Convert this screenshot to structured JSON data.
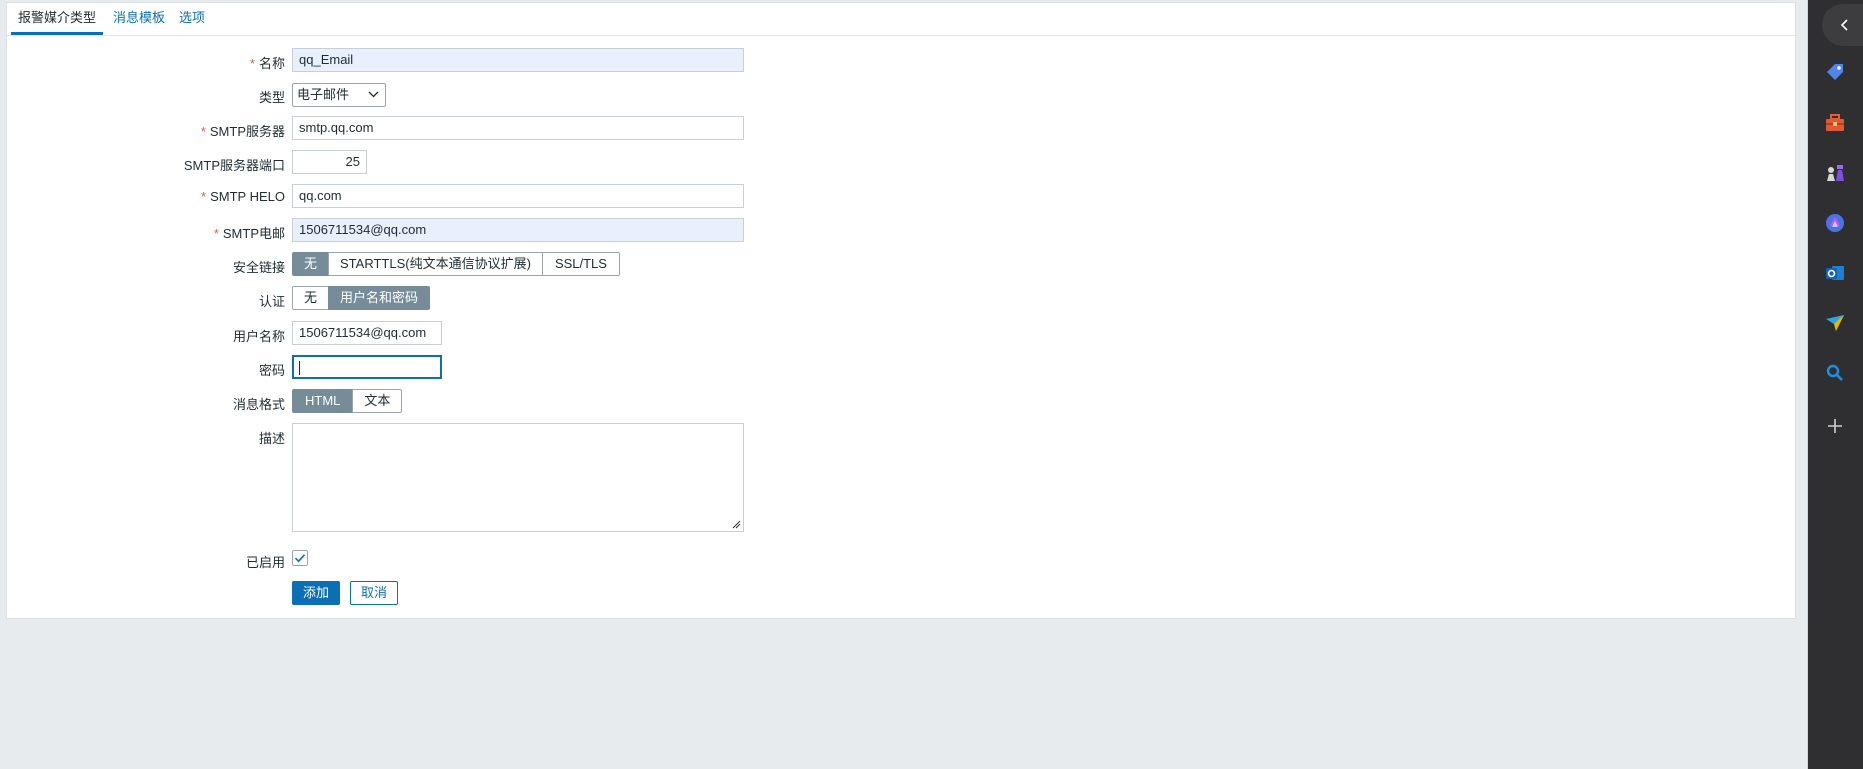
{
  "tabs": [
    {
      "label": "报警媒介类型",
      "active": true
    },
    {
      "label": "消息模板",
      "active": false
    },
    {
      "label": "选项",
      "active": false
    }
  ],
  "form": {
    "name": {
      "label": "名称",
      "required": true,
      "value": "qq_Email"
    },
    "type": {
      "label": "类型",
      "value": "电子邮件"
    },
    "smtp_server": {
      "label": "SMTP服务器",
      "required": true,
      "value": "smtp.qq.com"
    },
    "smtp_port": {
      "label": "SMTP服务器端口",
      "value": "25"
    },
    "smtp_helo": {
      "label": "SMTP HELO",
      "required": true,
      "value": "qq.com"
    },
    "smtp_email": {
      "label": "SMTP电邮",
      "required": true,
      "value": "1506711534@qq.com"
    },
    "security": {
      "label": "安全链接",
      "options": [
        "无",
        "STARTTLS(纯文本通信协议扩展)",
        "SSL/TLS"
      ],
      "selected": "无"
    },
    "auth": {
      "label": "认证",
      "options": [
        "无",
        "用户名和密码"
      ],
      "selected": "用户名和密码"
    },
    "username": {
      "label": "用户名称",
      "value": "1506711534@qq.com"
    },
    "password": {
      "label": "密码",
      "value": ""
    },
    "message_format": {
      "label": "消息格式",
      "options": [
        "HTML",
        "文本"
      ],
      "selected": "HTML"
    },
    "description": {
      "label": "描述",
      "value": ""
    },
    "enabled": {
      "label": "已启用",
      "checked": true
    },
    "add_label": "添加",
    "cancel_label": "取消"
  },
  "required_marker": "*",
  "sidebar": {
    "icons": [
      "collapse-chevron-icon",
      "tag-icon",
      "toolbox-icon",
      "chess-icon",
      "copilot-icon",
      "outlook-icon",
      "send-icon",
      "search-icon",
      "add-icon"
    ]
  },
  "colors": {
    "accent": "#0b6fb6",
    "selected_segment": "#768d99",
    "required": "#e45959",
    "autofill": "#e8f0fe",
    "rail_background": "#2f2f31"
  }
}
